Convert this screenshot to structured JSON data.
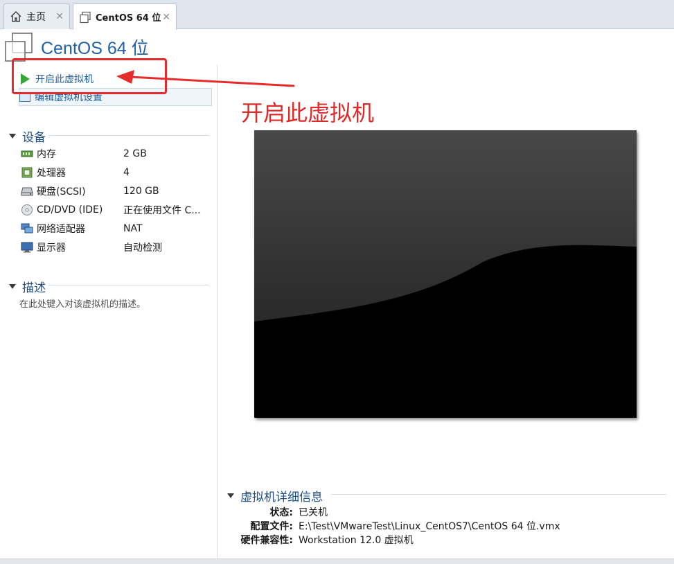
{
  "tabs": [
    {
      "label": "主页"
    },
    {
      "label": "CentOS 64 位"
    }
  ],
  "tab_close_glyph": "✕",
  "header": {
    "title": "CentOS 64 位"
  },
  "actions": {
    "start_label": "开启此虚拟机",
    "edit_label": "编辑虚拟机设置"
  },
  "annotation": {
    "text": "开启此虚拟机",
    "color": "#e02a2a"
  },
  "devices": {
    "title": "设备",
    "items": [
      {
        "name": "内存",
        "value": "2 GB",
        "icon": "memory-icon"
      },
      {
        "name": "处理器",
        "value": "4",
        "icon": "processor-icon"
      },
      {
        "name": "硬盘(SCSI)",
        "value": "120 GB",
        "icon": "hard-disk-icon"
      },
      {
        "name": "CD/DVD (IDE)",
        "value": "正在使用文件 C...",
        "icon": "cd-dvd-icon"
      },
      {
        "name": "网络适配器",
        "value": "NAT",
        "icon": "network-adapter-icon"
      },
      {
        "name": "显示器",
        "value": "自动检测",
        "icon": "display-icon"
      }
    ]
  },
  "description": {
    "title": "描述",
    "placeholder": "在此处键入对该虚拟机的描述。"
  },
  "details": {
    "title": "虚拟机详细信息",
    "rows": [
      {
        "key": "状态:",
        "value": "已关机"
      },
      {
        "key": "配置文件:",
        "value": "E:\\Test\\VMwareTest\\Linux_CentOS7\\CentOS 64 位.vmx"
      },
      {
        "key": "硬件兼容性:",
        "value": "Workstation 12.0 虚拟机"
      }
    ]
  },
  "colors": {
    "accent": "#1f5fa8",
    "play": "#3aa537",
    "annotation": "#e52b2b"
  }
}
